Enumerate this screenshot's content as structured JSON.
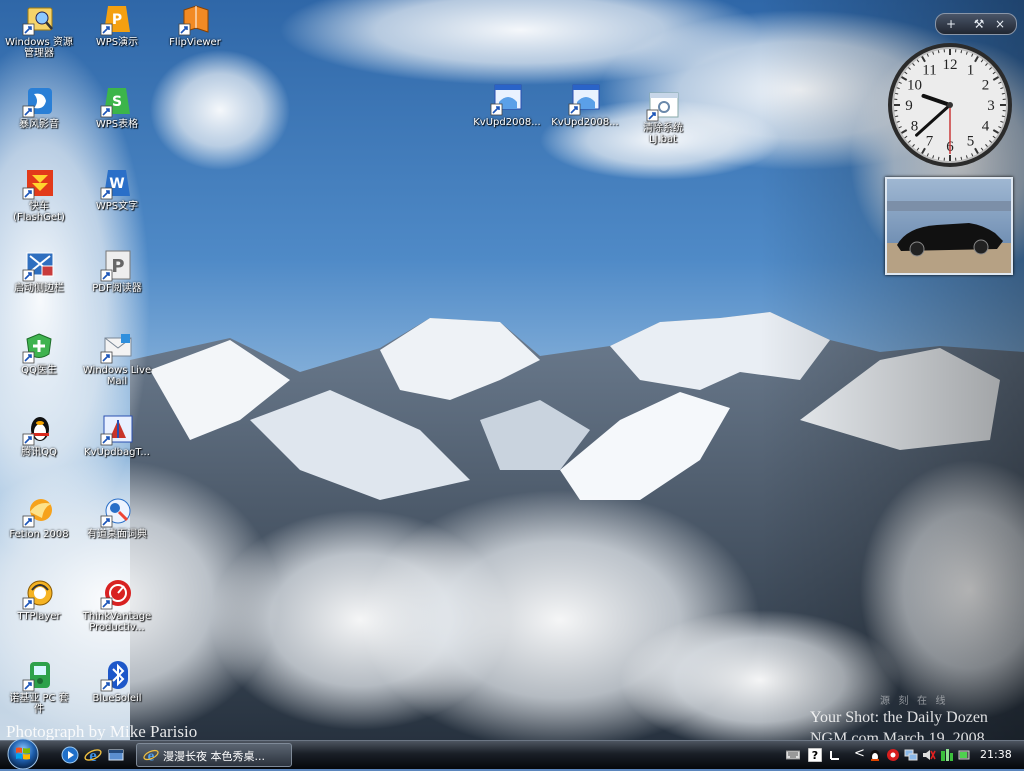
{
  "desktop": {
    "icons": [
      {
        "label": "Windows 资源\n管理器",
        "name": "desktop-icon-windows-explorer",
        "icon": "explorer-icon"
      },
      {
        "label": "暴风影音",
        "name": "desktop-icon-baofeng",
        "icon": "baofeng-player-icon"
      },
      {
        "label": "快车\n(FlashGet)",
        "name": "desktop-icon-flashget",
        "icon": "flashget-icon"
      },
      {
        "label": "启动侧边栏",
        "name": "desktop-icon-sidebar",
        "icon": "sidebar-icon"
      },
      {
        "label": "QQ医生",
        "name": "desktop-icon-qq-doctor",
        "icon": "qq-doctor-icon"
      },
      {
        "label": "腾讯QQ",
        "name": "desktop-icon-tencent-qq",
        "icon": "qq-penguin-icon"
      },
      {
        "label": "Fetion 2008",
        "name": "desktop-icon-fetion",
        "icon": "fetion-icon"
      },
      {
        "label": "TTPlayer",
        "name": "desktop-icon-ttplayer",
        "icon": "ttplayer-icon"
      },
      {
        "label": "诺基亚 PC 套\n件",
        "name": "desktop-icon-nokia-pc-suite",
        "icon": "nokia-pc-suite-icon"
      },
      {
        "label": "WPS演示",
        "name": "desktop-icon-wps-presentation",
        "icon": "wps-presentation-icon"
      },
      {
        "label": "WPS表格",
        "name": "desktop-icon-wps-spreadsheet",
        "icon": "wps-spreadsheet-icon"
      },
      {
        "label": "WPS文字",
        "name": "desktop-icon-wps-writer",
        "icon": "wps-writer-icon"
      },
      {
        "label": "PDF阅读器",
        "name": "desktop-icon-pdf-reader",
        "icon": "pdf-reader-icon"
      },
      {
        "label": "Windows Live\nMail",
        "name": "desktop-icon-windows-live-mail",
        "icon": "windows-live-mail-icon"
      },
      {
        "label": "KvUpdbagT...",
        "name": "desktop-icon-kvupdbag",
        "icon": "kv-update-icon"
      },
      {
        "label": "有道桌面词典",
        "name": "desktop-icon-youdao-dict",
        "icon": "youdao-dictionary-icon"
      },
      {
        "label": "ThinkVantage\nProductiv...",
        "name": "desktop-icon-thinkvantage",
        "icon": "thinkvantage-icon"
      },
      {
        "label": "BlueSoleil",
        "name": "desktop-icon-bluesoleil",
        "icon": "bluetooth-icon"
      },
      {
        "label": "FlipViewer",
        "name": "desktop-icon-flipviewer",
        "icon": "flipviewer-icon"
      },
      {
        "label": "KvUpd2008...",
        "name": "desktop-icon-kvupd2008-1",
        "icon": "kv-installer-icon"
      },
      {
        "label": "KvUpd2008...",
        "name": "desktop-icon-kvupd2008-2",
        "icon": "kv-installer-icon"
      },
      {
        "label": "清除系统\nLJ.bat",
        "name": "desktop-icon-clean-bat",
        "icon": "batch-file-icon"
      }
    ]
  },
  "sidebar": {
    "toolbar": {
      "add": "+",
      "tools": "⚒",
      "close": "×"
    },
    "clock": {
      "numbers": [
        "12",
        "1",
        "2",
        "3",
        "4",
        "5",
        "6",
        "7",
        "8",
        "9",
        "10",
        "11"
      ],
      "hour": 9,
      "minute": 38,
      "second": 30
    }
  },
  "wallpaper": {
    "credit": "Photograph by Mike Parisio",
    "watermark_line1": "Your Shot: the Daily Dozen",
    "watermark_line2": "NGM.com  March 19, 2008",
    "watermark_brand": "源 刻 在 线"
  },
  "taskbar": {
    "window_title": "漫漫长夜 本色秀桌...",
    "clock": "21:38",
    "tray_chevron": "<",
    "quick_launch": [
      "media-player-icon",
      "internet-explorer-icon",
      "show-desktop-icon"
    ]
  }
}
